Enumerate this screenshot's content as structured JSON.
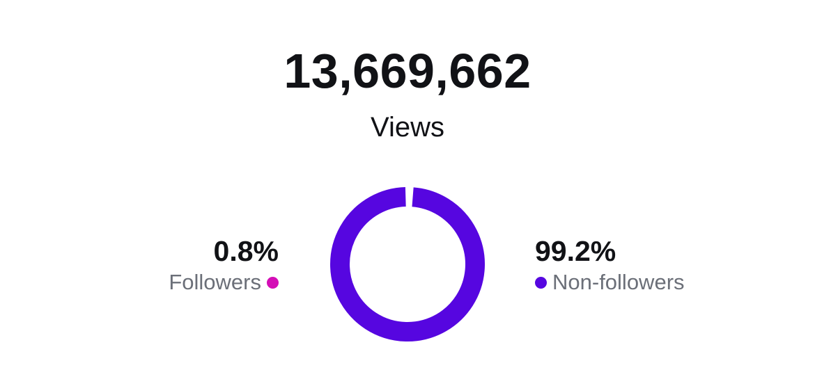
{
  "summary": {
    "total": "13,669,662",
    "total_label": "Views"
  },
  "chart_data": {
    "type": "pie",
    "variant": "donut",
    "title": "",
    "slices": [
      {
        "label": "Followers",
        "value": 0.8,
        "display": "0.8%",
        "color": "#d40eb6"
      },
      {
        "label": "Non-followers",
        "value": 99.2,
        "display": "99.2%",
        "color": "#5606e0"
      }
    ]
  }
}
